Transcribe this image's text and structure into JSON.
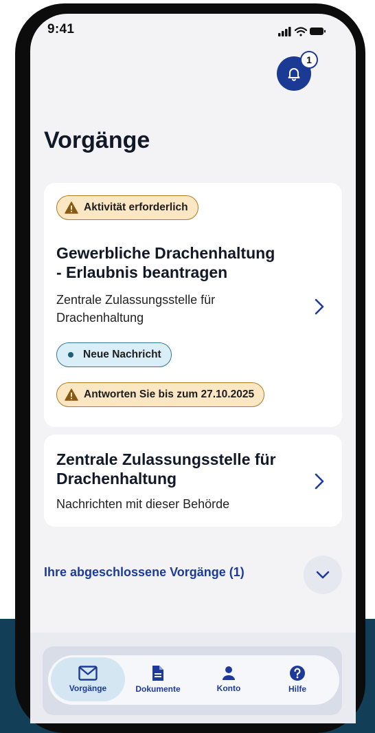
{
  "status_bar": {
    "time": "9:41"
  },
  "notifications": {
    "count": "1"
  },
  "header": {
    "title": "Vorgänge"
  },
  "cards": [
    {
      "status_badge": "Aktivität erforderlich",
      "title_line1": "Gewerbliche Drachenhaltung",
      "title_line2": "- Erlaubnis beantragen",
      "subtitle_line1": "Zentrale Zulassungsstelle für",
      "subtitle_line2": "Drachenhaltung",
      "message_badge": "Neue Nachricht",
      "deadline_badge": "Antworten Sie bis zum 27.10.2025"
    },
    {
      "title_line1": "Zentrale Zulassungsstelle für",
      "title_line2": "Drachenhaltung",
      "subtitle": "Nachrichten mit dieser Behörde"
    }
  ],
  "completed": {
    "label": "Ihre abgeschlossene Vorgänge (1)"
  },
  "nav": {
    "items": [
      {
        "label": "Vorgänge",
        "icon": "envelope-icon",
        "active": true
      },
      {
        "label": "Dokumente",
        "icon": "document-icon",
        "active": false
      },
      {
        "label": "Konto",
        "icon": "person-icon",
        "active": false
      },
      {
        "label": "Hilfe",
        "icon": "help-icon",
        "active": false
      }
    ]
  },
  "colors": {
    "primary": "#1d3a9b",
    "warning_bg": "#fbe7c4",
    "warning_border": "#b07a22",
    "info_bg": "#d9eef7",
    "info_border": "#2f7896",
    "page_band": "#123e57"
  }
}
